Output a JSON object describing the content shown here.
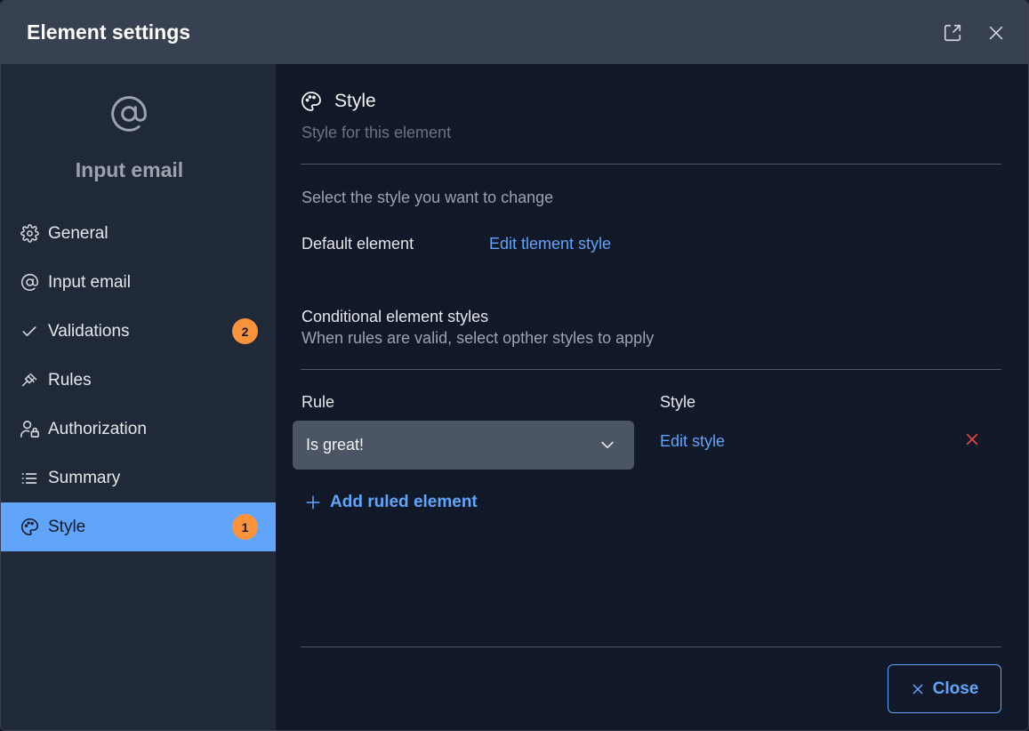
{
  "dialog": {
    "title": "Element settings",
    "expand_icon": "expand-icon",
    "close_icon": "close-icon"
  },
  "sidebar": {
    "icon": "at-icon",
    "title": "Input email",
    "items": [
      {
        "label": "General",
        "icon": "gear-icon",
        "badge": ""
      },
      {
        "label": "Input email",
        "icon": "at-icon",
        "badge": ""
      },
      {
        "label": "Validations",
        "icon": "check-icon",
        "badge": "2"
      },
      {
        "label": "Rules",
        "icon": "gavel-icon",
        "badge": ""
      },
      {
        "label": "Authorization",
        "icon": "user-lock-icon",
        "badge": ""
      },
      {
        "label": "Summary",
        "icon": "list-icon",
        "badge": ""
      },
      {
        "label": "Style",
        "icon": "palette-icon",
        "badge": "1",
        "active": true
      }
    ]
  },
  "main": {
    "section_icon": "palette-icon",
    "section_title": "Style",
    "section_subtitle": "Style for this element",
    "select_hint": "Select the style you want to change",
    "default_label": "Default element",
    "default_link": "Edit tlement style",
    "conditional_title": "Conditional element styles",
    "conditional_subtitle": "When rules are valid, select opther styles to apply",
    "col_rule": "Rule",
    "col_style": "Style",
    "rows": [
      {
        "rule": "Is great!",
        "style_link": "Edit style"
      }
    ],
    "add_ruled": "Add ruled element",
    "close_label": "Close"
  },
  "colors": {
    "accent": "#60a5fa",
    "badge": "#fb923c",
    "danger": "#ef4444",
    "header_bg": "#374151",
    "sidebar_bg": "#1f2937",
    "main_bg": "#111827"
  }
}
